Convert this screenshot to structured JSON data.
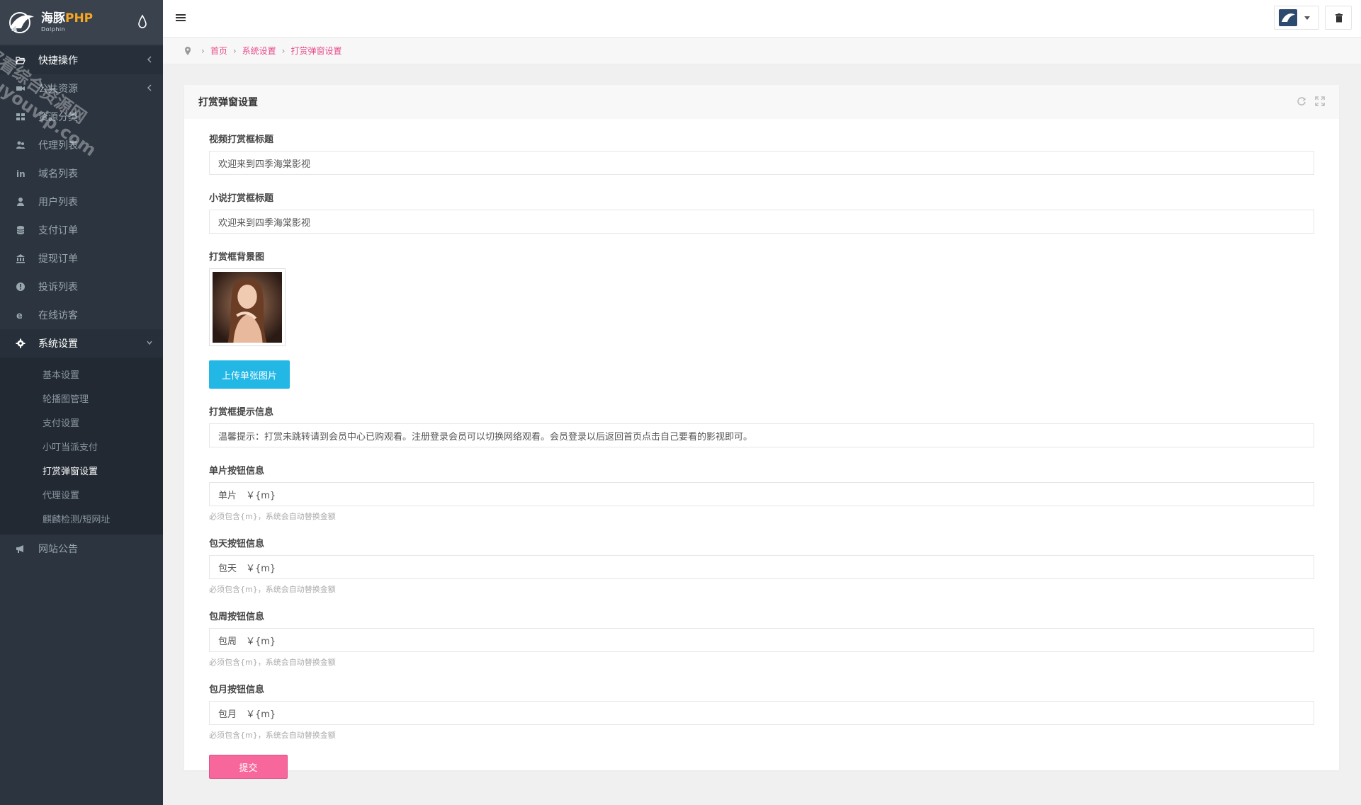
{
  "brand": {
    "name_cn": "海豚",
    "name_php": "PHP",
    "name_en": "Dolphin"
  },
  "sidebar": {
    "items": [
      {
        "label": "快捷操作",
        "icon": "folder-open-icon"
      },
      {
        "label": "公共资源",
        "icon": "video-icon"
      },
      {
        "label": "资源分类",
        "icon": "grid-icon"
      },
      {
        "label": "代理列表",
        "icon": "users-icon"
      },
      {
        "label": "域名列表",
        "icon": "linkedin-icon"
      },
      {
        "label": "用户列表",
        "icon": "user-icon"
      },
      {
        "label": "支付订单",
        "icon": "database-icon"
      },
      {
        "label": "提现订单",
        "icon": "bank-icon"
      },
      {
        "label": "投诉列表",
        "icon": "info-icon"
      },
      {
        "label": "在线访客",
        "icon": "ie-icon"
      },
      {
        "label": "系统设置",
        "icon": "gear-icon"
      },
      {
        "label": "网站公告",
        "icon": "bullhorn-icon"
      }
    ],
    "sub_items": [
      "基本设置",
      "轮播图管理",
      "支付设置",
      "小叮当派支付",
      "打赏弹窗设置",
      "代理设置",
      "麒麟检测/短网址"
    ]
  },
  "breadcrumb": {
    "home": "首页",
    "section": "系统设置",
    "current": "打赏弹窗设置"
  },
  "card": {
    "title": "打赏弹窗设置"
  },
  "form": {
    "video_title_label": "视频打赏框标题",
    "video_title_value": "欢迎来到四季海棠影视",
    "novel_title_label": "小说打赏框标题",
    "novel_title_value": "欢迎来到四季海棠影视",
    "bg_label": "打赏框背景图",
    "upload_label": "上传单张图片",
    "tip_label": "打赏框提示信息",
    "tip_value": "温馨提示：打赏未跳转请到会员中心已购观看。注册登录会员可以切换网络观看。会员登录以后返回首页点击自己要看的影视即可。",
    "single_label": "单片按钮信息",
    "single_value": "单片　￥{m}",
    "single_help": "必须包含{m}，系统会自动替换金额",
    "day_label": "包天按钮信息",
    "day_value": "包天　￥{m}",
    "day_help": "必须包含{m}，系统会自动替换金额",
    "week_label": "包周按钮信息",
    "week_value": "包周　￥{m}",
    "week_help": "必须包含{m}，系统会自动替换金额",
    "month_label": "包月按钮信息",
    "month_value": "包月　￥{m}",
    "month_help": "必须包含{m}，系统会自动替换金额",
    "submit_label": "提交"
  },
  "watermark": {
    "line1": "都看综合资源网",
    "line2": "douyouvip.com"
  },
  "colors": {
    "sidebar_bg": "#2c343f",
    "accent_pink": "#f7679b",
    "upload_blue": "#23b7e5",
    "breadcrumb_link": "#e84c8b"
  }
}
